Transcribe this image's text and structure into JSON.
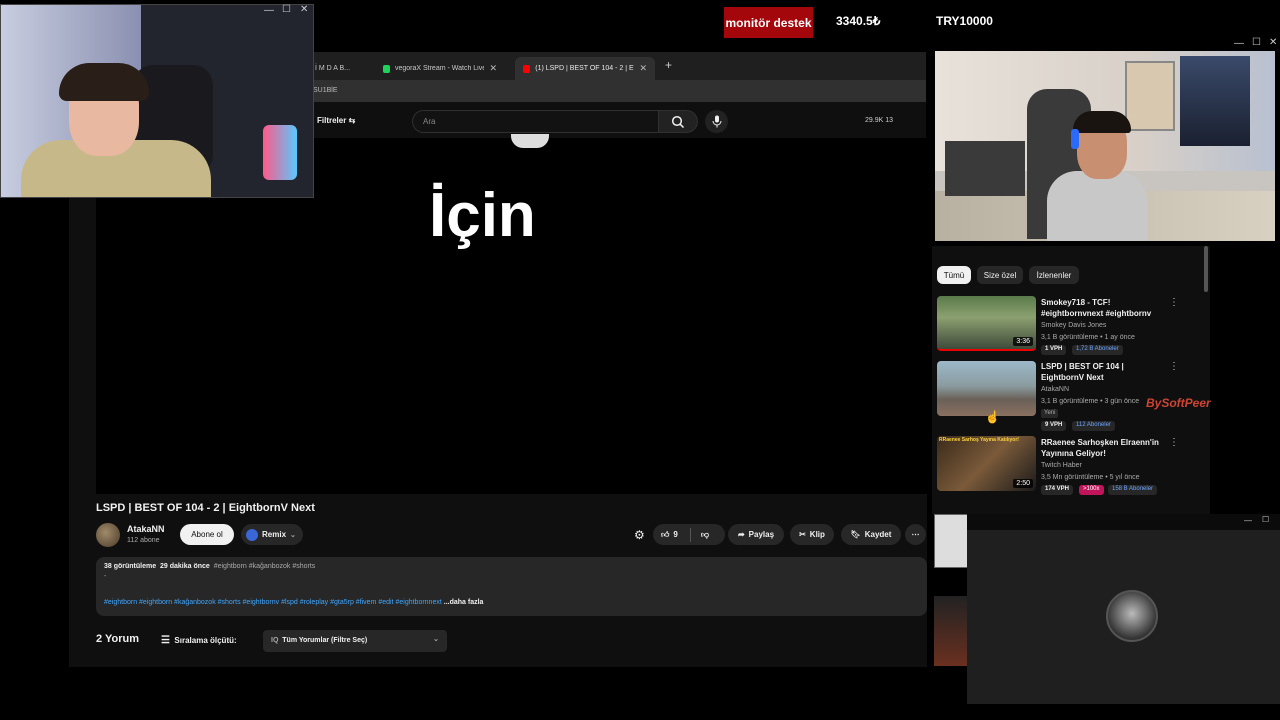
{
  "overlay": {
    "badge": "monitör destek",
    "number": "3340.5₺",
    "goal": "TRY10000"
  },
  "browser": {
    "tabs": [
      {
        "label": "İ M D A B..."
      },
      {
        "label": "vegoraX Stream - Watch Live o..."
      },
      {
        "label": "(1) LSPD | BEST OF 104 - 2 | Eig..."
      }
    ],
    "addr_text": "SU1BlE",
    "filtreler": "Filtreler",
    "search_placeholder": "Ara",
    "stats": "29.9K   13"
  },
  "video": {
    "overlay_text": "İçin",
    "title": "LSPD | BEST OF 104 - 2 | EightbornV Next",
    "channel": "AtakaNN",
    "subs": "112 abone",
    "subscribe": "Abone ol",
    "remix": "Remix",
    "likes": "9",
    "share": "Paylaş",
    "clip": "Klip",
    "save": "Kaydet"
  },
  "description": {
    "views": "38 görüntüleme",
    "time": "29 dakika önce",
    "tags_top": "#eightborn #kağanbozok #shorts",
    "dash": "-",
    "tags_bottom": "#eightborn #eightborn #kağanbozok #shorts #eightbornv #lspd #roleplay #gta5rp #fivem #edit #eightbornnext",
    "more": "...daha fazla"
  },
  "comments": {
    "count": "2 Yorum",
    "sort": "Sıralama ölçütü:",
    "filter": "Tüm Yorumlar (Filtre Seç)"
  },
  "sidebar": {
    "chips": [
      "Tümü",
      "Size özel",
      "İzlenenler"
    ],
    "videos": [
      {
        "title": "Smokey718 - TCF! #eightbornvnext #eightbornv",
        "channel": "Smokey Davis Jones",
        "meta": "3,1 B görüntüleme • 1 ay önce",
        "vph": "1 VPH",
        "subs": "1,72 B Aboneler",
        "duration": "3:36"
      },
      {
        "title": "LSPD | BEST OF 104 | EightbornV Next",
        "channel": "AtakaNN",
        "meta": "3,1 B görüntüleme • 3 gün önce",
        "badge": "Yeni",
        "vph": "9 VPH",
        "subs": "112 Aboneler",
        "duration": ""
      },
      {
        "title": "RRaenee Sarhoşken Elraenn'in Yayınına Geliyor!",
        "channel": "Twitch Haber",
        "meta": "3,5 Mn görüntüleme • 5 yıl önce",
        "vph": "174 VPH",
        "extra": ">100x",
        "subs": "158 B Aboneler",
        "duration": "2:50"
      }
    ],
    "thumb3_caption": "RRaenee Sarhoş Yayına Katılıyor!"
  },
  "watermark": "BySoftPeer"
}
